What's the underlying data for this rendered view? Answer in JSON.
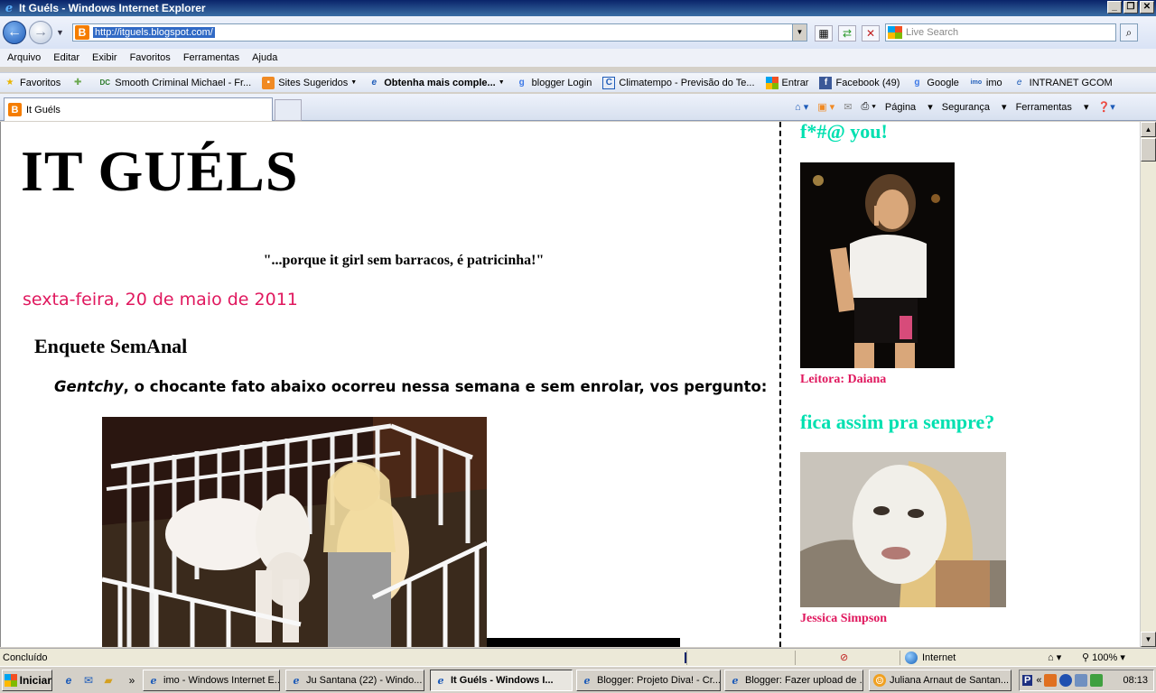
{
  "window": {
    "title": "It Guéls - Windows Internet Explorer",
    "controls": [
      "_",
      "❐",
      "✕"
    ]
  },
  "address_bar": {
    "url": "http://itguels.blogspot.com/",
    "search_placeholder": "Live Search"
  },
  "menu": {
    "items": [
      "Arquivo",
      "Editar",
      "Exibir",
      "Favoritos",
      "Ferramentas",
      "Ajuda"
    ]
  },
  "favorites_bar": {
    "favorites_label": "Favoritos",
    "items": [
      {
        "label": "Smooth Criminal Michael - Fr...",
        "icon": "dc-icon"
      },
      {
        "label": "Sites Sugeridos",
        "icon": "orange-page-icon",
        "dropdown": true
      },
      {
        "label": "Obtenha mais comple...",
        "icon": "ie-page-icon",
        "dropdown": true,
        "bold": true
      },
      {
        "label": "blogger Login",
        "icon": "google-icon"
      },
      {
        "label": "Climatempo - Previsão do Te...",
        "icon": "climatempo-icon"
      },
      {
        "label": "Entrar",
        "icon": "msn-icon"
      },
      {
        "label": "Facebook (49)",
        "icon": "facebook-icon"
      },
      {
        "label": "Google",
        "icon": "google-icon"
      },
      {
        "label": "imo",
        "icon": "imo-icon"
      },
      {
        "label": "INTRANET GCOM",
        "icon": "ie-page-icon"
      }
    ]
  },
  "tabs": [
    {
      "label": "It Guéls"
    }
  ],
  "command_bar": {
    "items": [
      "Página",
      "Segurança",
      "Ferramentas"
    ]
  },
  "page": {
    "blog_title": "IT GUÉLS",
    "tagline": "\"...porque it girl sem barracos, é patricinha!\"",
    "date_header": "sexta-feira, 20 de maio de 2011",
    "post_title": "Enquete SemAnal",
    "post_intro_em": "Gentchy",
    "post_intro_rest": ", o chocante fato abaixo ocorreu nessa semana e sem enrolar, vos pergunto:",
    "sidebar": [
      {
        "heading": "f*#@ you!",
        "caption": "Leitora: Daiana"
      },
      {
        "heading": "fica assim pra sempre?",
        "caption": "Jessica Simpson"
      }
    ]
  },
  "status_bar": {
    "status": "Concluído",
    "zone": "Internet",
    "zoom": "100%"
  },
  "taskbar": {
    "start_label": "Iniciar",
    "tasks": [
      {
        "label": "imo - Windows Internet E...",
        "active": false
      },
      {
        "label": "Ju Santana (22) - Windo...",
        "active": false
      },
      {
        "label": "It Guéls - Windows I...",
        "active": true
      },
      {
        "label": "Blogger: Projeto Diva! - Cr...",
        "active": false
      },
      {
        "label": "Blogger: Fazer upload de ...",
        "active": false
      },
      {
        "label": "Juliana Arnaut de Santan...",
        "active": false
      }
    ],
    "clock": "08:13"
  },
  "colors": {
    "accent_pink": "#e0185e",
    "sidebar_heading": "#00e0b0",
    "selection_blue": "#316ac5"
  }
}
